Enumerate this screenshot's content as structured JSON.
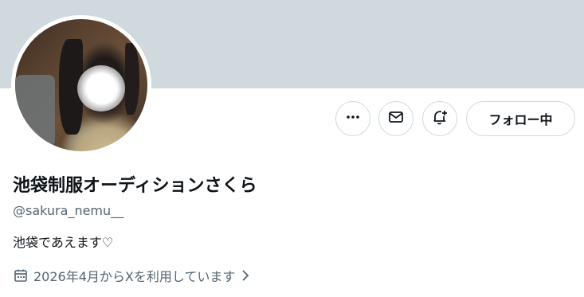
{
  "profile": {
    "display_name": "池袋制服オーディションさくら",
    "handle": "@sakura_nemu__",
    "bio": "池袋であえます♡",
    "joined": "2026年4月からXを利用しています"
  },
  "actions": {
    "more_icon": "more-icon",
    "message_icon": "envelope-icon",
    "notify_icon": "bell-plus-icon",
    "follow_label": "フォロー中"
  },
  "colors": {
    "banner": "#cfd9de",
    "text_primary": "#0f1419",
    "text_secondary": "#536471",
    "border": "#cfd9de"
  }
}
